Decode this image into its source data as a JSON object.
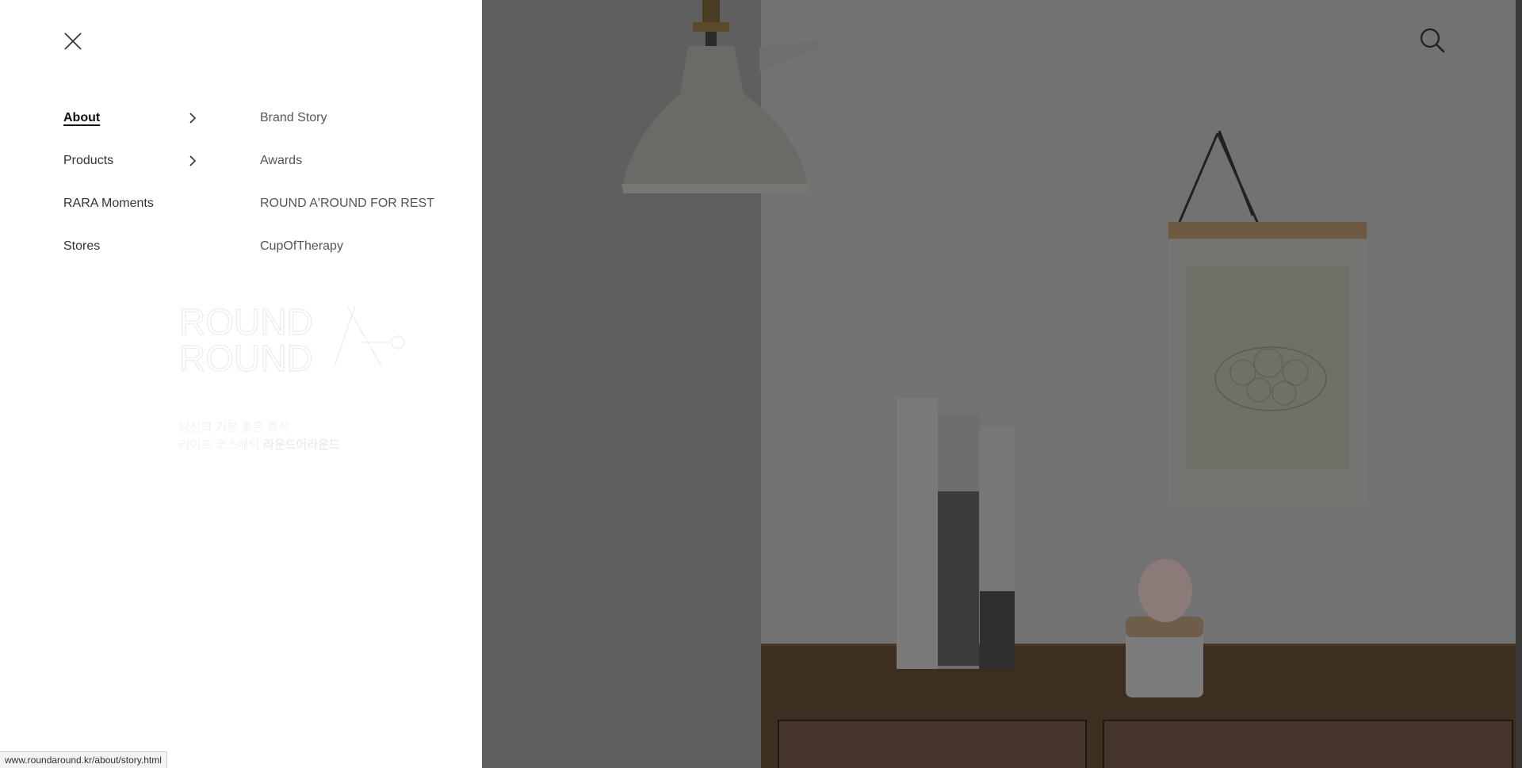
{
  "header": {
    "close_icon": "close-icon",
    "search_icon": "search-icon"
  },
  "menu": {
    "items": [
      {
        "label": "About",
        "active": true,
        "has_submenu": true
      },
      {
        "label": "Products",
        "active": false,
        "has_submenu": true
      },
      {
        "label": "RARA Moments",
        "active": false,
        "has_submenu": false
      },
      {
        "label": "Stores",
        "active": false,
        "has_submenu": false
      }
    ],
    "submenu": [
      {
        "label": "Brand Story"
      },
      {
        "label": "Awards"
      },
      {
        "label": "ROUND A'ROUND FOR REST"
      },
      {
        "label": "CupOfTherapy"
      }
    ]
  },
  "brand": {
    "logo_line1": "ROUND",
    "logo_line2": "ROUND",
    "tagline_line1": "당신의 기분 좋은 휴식",
    "tagline_line2_prefix": "라이프 코스메틱 ",
    "tagline_line2_brand": "라운드어라운드"
  },
  "status_bar": {
    "url": "www.roundaround.kr/about/story.html"
  },
  "colors": {
    "panel_bg": "#ffffff",
    "overlay_tint": "#6b6b6b",
    "text_primary": "#111111",
    "text_secondary": "#555555"
  }
}
